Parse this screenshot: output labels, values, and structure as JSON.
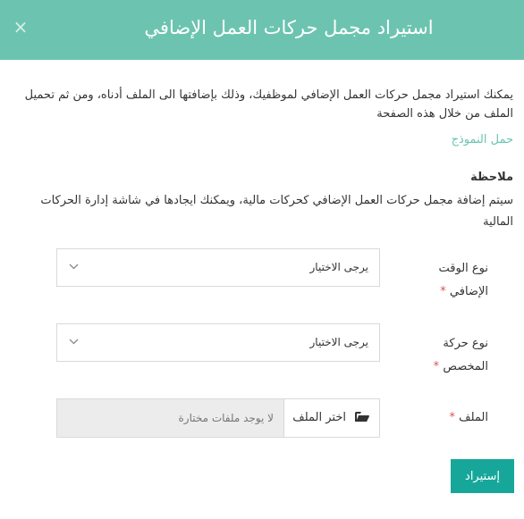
{
  "modal": {
    "title": "استيراد مجمل حركات العمل الإضافي",
    "close_symbol": "×"
  },
  "intro": {
    "text": "يمكنك استيراد مجمل حركات العمل الإضافي لموظفيك، وذلك بإضافتها الى الملف أدناه، ومن ثم تحميل الملف من خلال هذه الصفحة",
    "download_link": "حمل النموذج"
  },
  "note": {
    "title": "ملاحظة",
    "text": "سيتم إضافة مجمل حركات العمل الإضافي كحركات مالية، ويمكنك ايجادها في شاشة إدارة الحركات المالية"
  },
  "fields": {
    "overtime_type": {
      "label": "نوع الوقت الإضافي",
      "required_mark": "*",
      "selected": "يرجى الاختيار"
    },
    "custom_movement_type": {
      "label": "نوع حركة المخصص",
      "required_mark": "*",
      "selected": "يرجى الاختيار"
    },
    "file": {
      "label": "الملف",
      "required_mark": "*",
      "button_label": "اختر الملف",
      "no_file_text": "لا يوجد ملفات مختارة"
    }
  },
  "actions": {
    "import_label": "إستيراد"
  },
  "colors": {
    "header_bg": "#6cc4b0",
    "accent": "#17a79a",
    "link": "#6cc4b0",
    "required": "#e05050"
  }
}
